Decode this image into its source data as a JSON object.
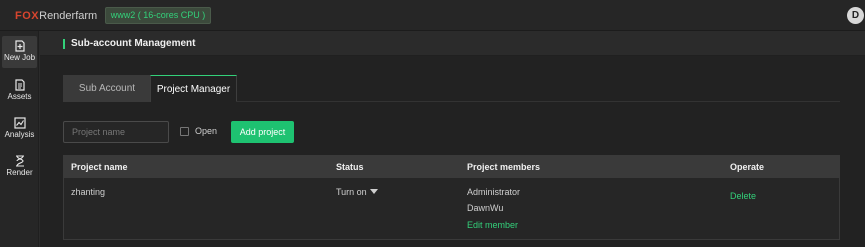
{
  "topbar": {
    "logo_fox": "FOX",
    "logo_rest": "Renderfarm",
    "cpu_badge": "www2 ( 16-cores CPU )",
    "avatar_letter": "D"
  },
  "sidebar": {
    "items": [
      {
        "label": "New Job",
        "icon": "new-job-icon"
      },
      {
        "label": "Assets",
        "icon": "assets-icon"
      },
      {
        "label": "Analysis",
        "icon": "analysis-icon"
      },
      {
        "label": "Render",
        "icon": "render-hourglass-icon"
      }
    ]
  },
  "header": {
    "title": "Sub-account Management"
  },
  "tabs": [
    {
      "label": "Sub Account"
    },
    {
      "label": "Project Manager"
    }
  ],
  "toolbar": {
    "search_placeholder": "Project name",
    "open_label": "Open",
    "add_label": "Add project"
  },
  "table": {
    "headers": [
      "Project name",
      "Status",
      "Project members",
      "Operate"
    ],
    "rows": [
      {
        "name": "zhanting",
        "status": "Turn on",
        "members": [
          "Administrator",
          "DawnWu"
        ],
        "edit_member": "Edit member",
        "operate": "Delete"
      }
    ]
  },
  "colors": {
    "accent": "#33d17a",
    "button": "#1ec271",
    "brand": "#d8452e",
    "background": "#222222"
  }
}
